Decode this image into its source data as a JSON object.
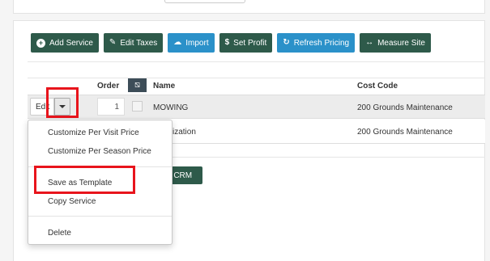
{
  "toolbar": {
    "buttons": [
      {
        "label": "Add Service",
        "icon": "plus-circle-icon",
        "color": "#2e5a4a"
      },
      {
        "label": "Edit Taxes",
        "icon": "pencil-square-icon",
        "color": "#2e5a4a"
      },
      {
        "label": "Import",
        "icon": "cloud-upload-icon",
        "color": "#2b91c9"
      },
      {
        "label": "Set Profit",
        "icon": "dollar-icon",
        "color": "#2e5a4a"
      },
      {
        "label": "Refresh Pricing",
        "icon": "refresh-icon",
        "color": "#2b91c9"
      },
      {
        "label": "Measure Site",
        "icon": "arrows-horizontal-icon",
        "color": "#2e5a4a"
      }
    ]
  },
  "table": {
    "headers": {
      "order": "Order",
      "name": "Name",
      "cost_code": "Cost Code"
    },
    "header_icon": "tag-slash-icon",
    "rows": [
      {
        "edit_label": "Edit",
        "order": "1",
        "name": "MOWING",
        "cost_code": "200 Grounds Maintenance"
      },
      {
        "name_visible": "ization",
        "cost_code": "200 Grounds Maintenance"
      }
    ]
  },
  "crm_button": {
    "label": "o CRM"
  },
  "dropdown": {
    "items": [
      "Customize Per Visit Price",
      "Customize Per Season Price",
      "Save as Template",
      "Copy Service",
      "Delete"
    ]
  },
  "colors": {
    "highlight": "#e8141c",
    "dark_green": "#2e5a4a",
    "blue": "#2b91c9"
  }
}
